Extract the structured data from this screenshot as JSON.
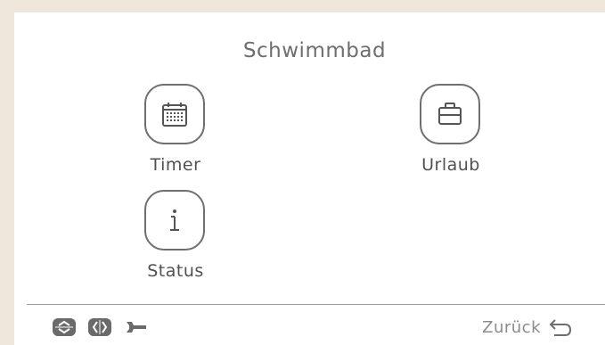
{
  "screen": {
    "title": "Schwimmbad"
  },
  "menu": {
    "items": [
      {
        "label": "Timer",
        "icon": "calendar-icon"
      },
      {
        "label": "Urlaub",
        "icon": "suitcase-icon"
      },
      {
        "label": "Status",
        "icon": "info-icon"
      }
    ]
  },
  "footer": {
    "icons": [
      "up-down-arrows-icon",
      "left-right-arrows-icon",
      "wrench-icon"
    ],
    "back_label": "Zurück",
    "back_icon": "return-arrow-icon"
  },
  "colors": {
    "frame": "#efe7dc",
    "text": "#505050",
    "outline": "#6f6f6f",
    "footer_icon": "#6a6a6a"
  }
}
